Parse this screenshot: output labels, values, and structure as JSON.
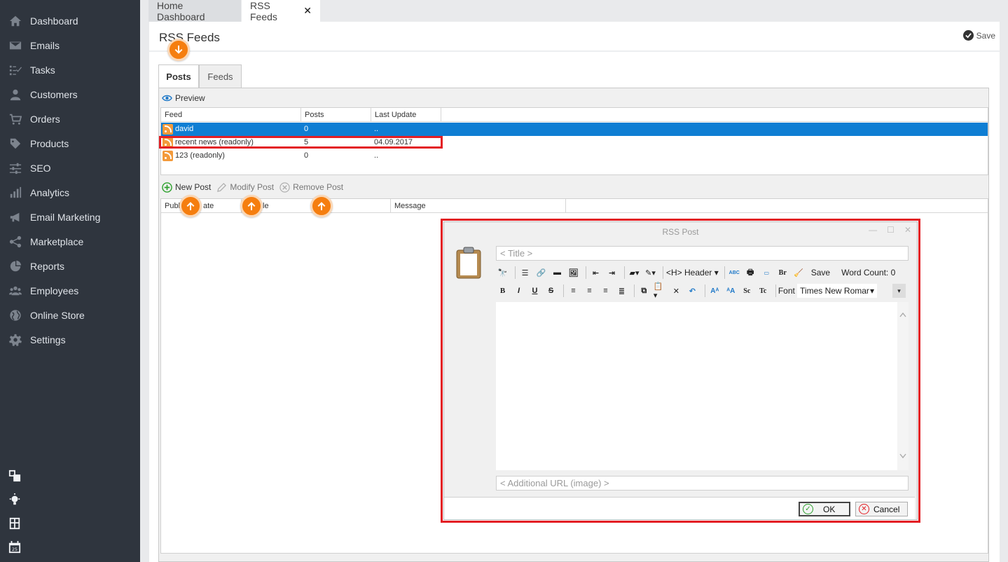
{
  "sidebar": {
    "items": [
      {
        "label": "Dashboard",
        "icon": "home-icon"
      },
      {
        "label": "Emails",
        "icon": "envelope-icon"
      },
      {
        "label": "Tasks",
        "icon": "tasks-icon"
      },
      {
        "label": "Customers",
        "icon": "user-icon"
      },
      {
        "label": "Orders",
        "icon": "cart-icon"
      },
      {
        "label": "Products",
        "icon": "tag-icon"
      },
      {
        "label": "SEO",
        "icon": "sliders-icon"
      },
      {
        "label": "Analytics",
        "icon": "bar-chart-icon"
      },
      {
        "label": "Email Marketing",
        "icon": "megaphone-icon"
      },
      {
        "label": "Marketplace",
        "icon": "share-icon"
      },
      {
        "label": "Reports",
        "icon": "pie-chart-icon"
      },
      {
        "label": "Employees",
        "icon": "group-icon"
      },
      {
        "label": "Online Store",
        "icon": "globe-icon"
      },
      {
        "label": "Settings",
        "icon": "gear-icon"
      }
    ],
    "bottom_icons": [
      "widgets-icon",
      "lightbulb-icon",
      "calculator-icon",
      "calendar-icon"
    ],
    "calendar_day": "25"
  },
  "tabs": {
    "home": "Home Dashboard",
    "rss": "RSS Feeds",
    "close": "✕"
  },
  "page": {
    "title": "RSS Feeds",
    "save_label": "Save"
  },
  "inner_tabs": {
    "posts": "Posts",
    "feeds": "Feeds"
  },
  "preview_label": "Preview",
  "feeds_grid": {
    "headers": [
      "Feed",
      "Posts",
      "Last Update"
    ],
    "rows": [
      {
        "feed": "david",
        "posts": "0",
        "last_update": "..",
        "selected": true
      },
      {
        "feed": "recent news (readonly)",
        "posts": "5",
        "last_update": "04.09.2017",
        "selected": false
      },
      {
        "feed": "123 (readonly)",
        "posts": "0",
        "last_update": "..",
        "selected": false
      }
    ]
  },
  "post_toolbar": {
    "new": "New Post",
    "modify": "Modify Post",
    "remove": "Remove Post"
  },
  "posts_grid": {
    "headers": [
      "Publ",
      "ate",
      "le",
      "Message"
    ]
  },
  "dialog": {
    "title": "RSS Post",
    "title_placeholder": "< Title >",
    "url_placeholder": "< Additional URL (image) >",
    "header_dropdown": "<H> Header",
    "save_label": "Save",
    "word_count": "Word Count: 0",
    "font_label": "Font",
    "font_value": "Times New Romar",
    "spell_label": "ABC",
    "br_label": "Br",
    "sc_label": "Sc",
    "tc_label": "Tc",
    "bold": "B",
    "italic": "I",
    "underline": "U",
    "strike": "S",
    "ok_label": "OK",
    "cancel_label": "Cancel"
  },
  "colors": {
    "accent_orange": "#f57e0f",
    "highlight_red": "#e31e24",
    "selection_blue": "#0f7ed3",
    "sidebar_bg": "#2f353e"
  }
}
